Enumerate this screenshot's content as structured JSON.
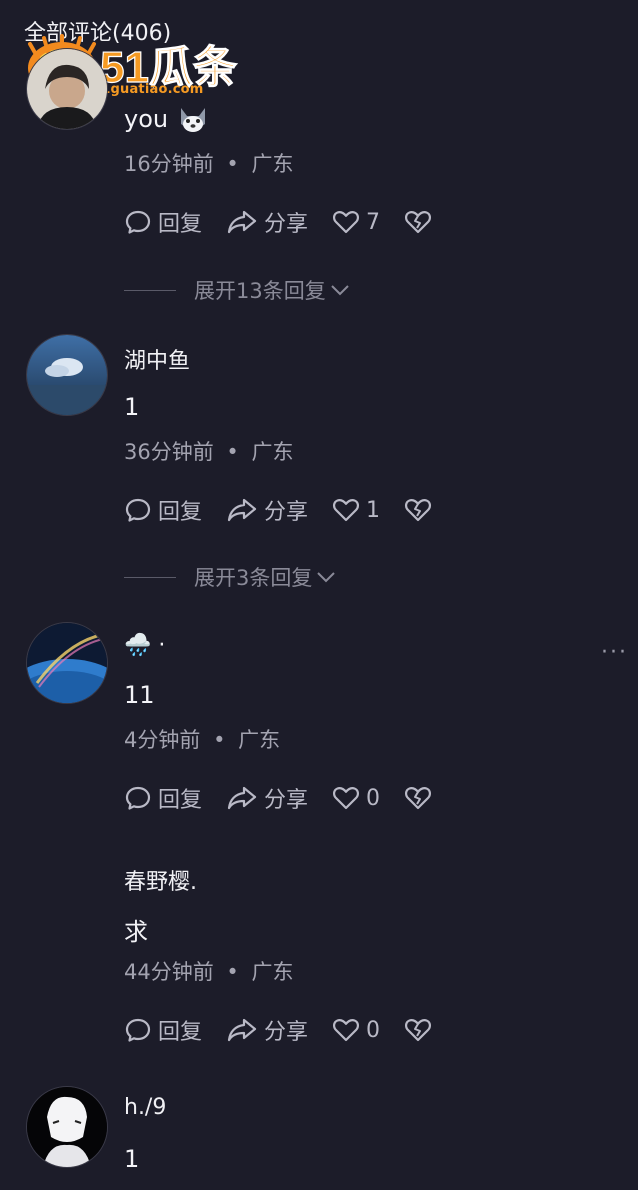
{
  "header": {
    "title": "全部评论(406)"
  },
  "watermark": {
    "brand": "51瓜条",
    "url": "51guatiao.com"
  },
  "icons": {
    "reply": "speech-bubble-icon",
    "share": "share-arrow-icon",
    "like": "heart-outline-icon",
    "dislike": "broken-heart-icon",
    "expand": "chevron-down-icon",
    "more": "more-dots-icon"
  },
  "labels": {
    "reply": "回复",
    "share": "分享",
    "more": "···"
  },
  "comments": [
    {
      "content": "you",
      "time": "16分钟前",
      "location": "广东",
      "likes": "7",
      "expand": "展开13条回复"
    },
    {
      "username": "湖中鱼",
      "content": "1",
      "time": "36分钟前",
      "location": "广东",
      "likes": "1",
      "expand": "展开3条回复"
    },
    {
      "username": "🌧️ ·",
      "content": "11",
      "time": "4分钟前",
      "location": "广东",
      "likes": "0"
    },
    {
      "username": "春野樱.",
      "content": "求",
      "time": "44分钟前",
      "location": "广东",
      "likes": "0"
    },
    {
      "username": "h./9",
      "content": "1"
    }
  ],
  "separator": "•"
}
